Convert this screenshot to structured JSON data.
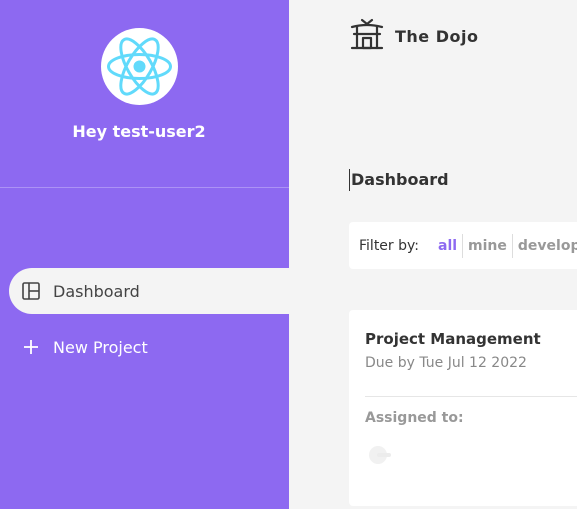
{
  "sidebar": {
    "greeting": "Hey test-user2",
    "nav": [
      {
        "label": "Dashboard",
        "icon": "dashboard-icon",
        "active": true
      },
      {
        "label": "New Project",
        "icon": "add-icon",
        "active": false
      }
    ]
  },
  "topbar": {
    "title": "The Dojo",
    "logo_icon": "temple-icon"
  },
  "main": {
    "page_title": "Dashboard",
    "filter": {
      "label": "Filter by:",
      "options": [
        "all",
        "mine",
        "development"
      ],
      "selected": "all"
    },
    "projects": [
      {
        "title": "Project Management",
        "due": "Due by Tue Jul 12 2022",
        "assigned_label": "Assigned to:"
      }
    ]
  },
  "colors": {
    "primary": "#8d69f1",
    "background": "#f4f4f4",
    "react_blue": "#61dafb"
  }
}
